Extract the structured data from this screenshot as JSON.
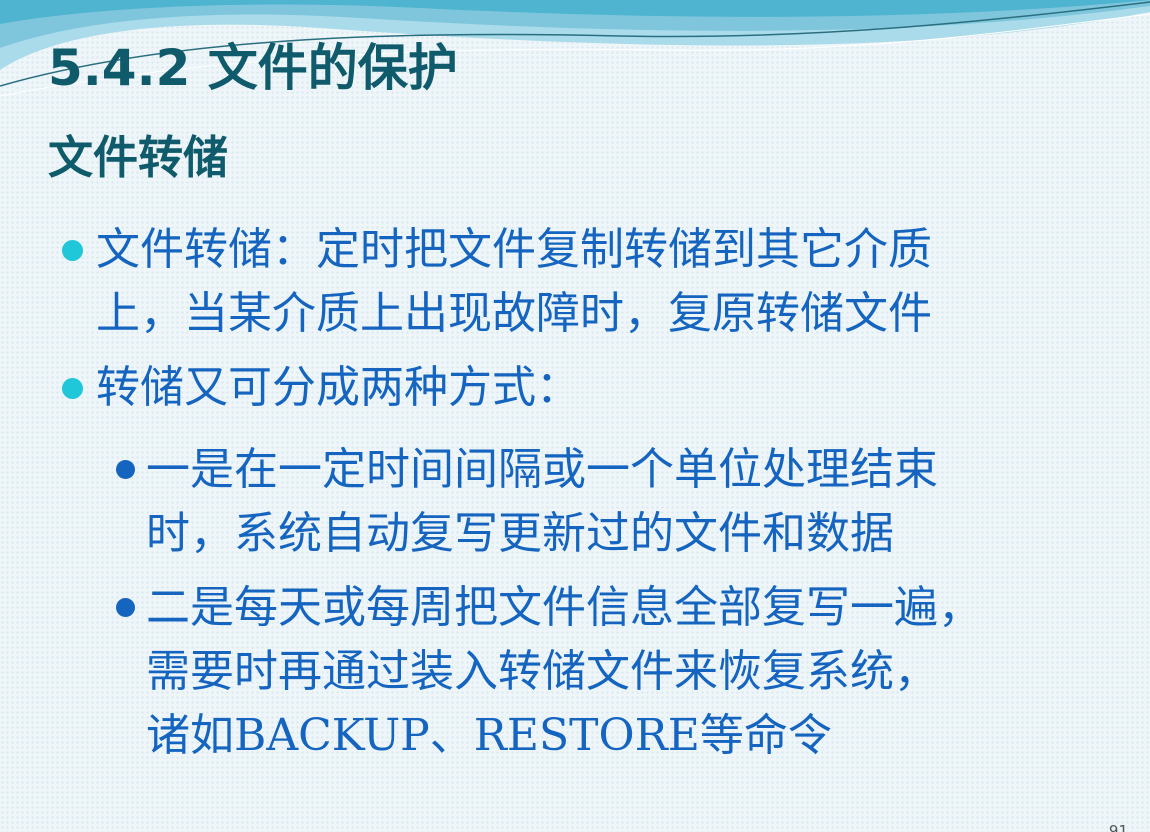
{
  "slide": {
    "title": "5.4.2 文件的保护",
    "subtitle": "文件转储",
    "items": [
      {
        "level": 1,
        "lines": [
          "文件转储：定时把文件复制转储到其它介质",
          "上，当某介质上出现故障时，复原转储文件"
        ]
      },
      {
        "level": 1,
        "lines": [
          "转储又可分成两种方式："
        ]
      },
      {
        "level": 2,
        "lines": [
          "一是在一定时间间隔或一个单位处理结束",
          "时，系统自动复写更新过的文件和数据"
        ]
      },
      {
        "level": 2,
        "lines": [
          "二是每天或每周把文件信息全部复写一遍，",
          "需要时再通过装入转储文件来恢复系统，",
          "诸如BACKUP、RESTORE等命令"
        ]
      }
    ],
    "page_number": "91"
  },
  "colors": {
    "title": "#0f5a6b",
    "body_text": "#1565c0",
    "bullet_level1": "#20c7d8",
    "bullet_level2": "#1565c0",
    "wave_light": "#a9dbea",
    "wave_mid": "#4fb4d0"
  }
}
